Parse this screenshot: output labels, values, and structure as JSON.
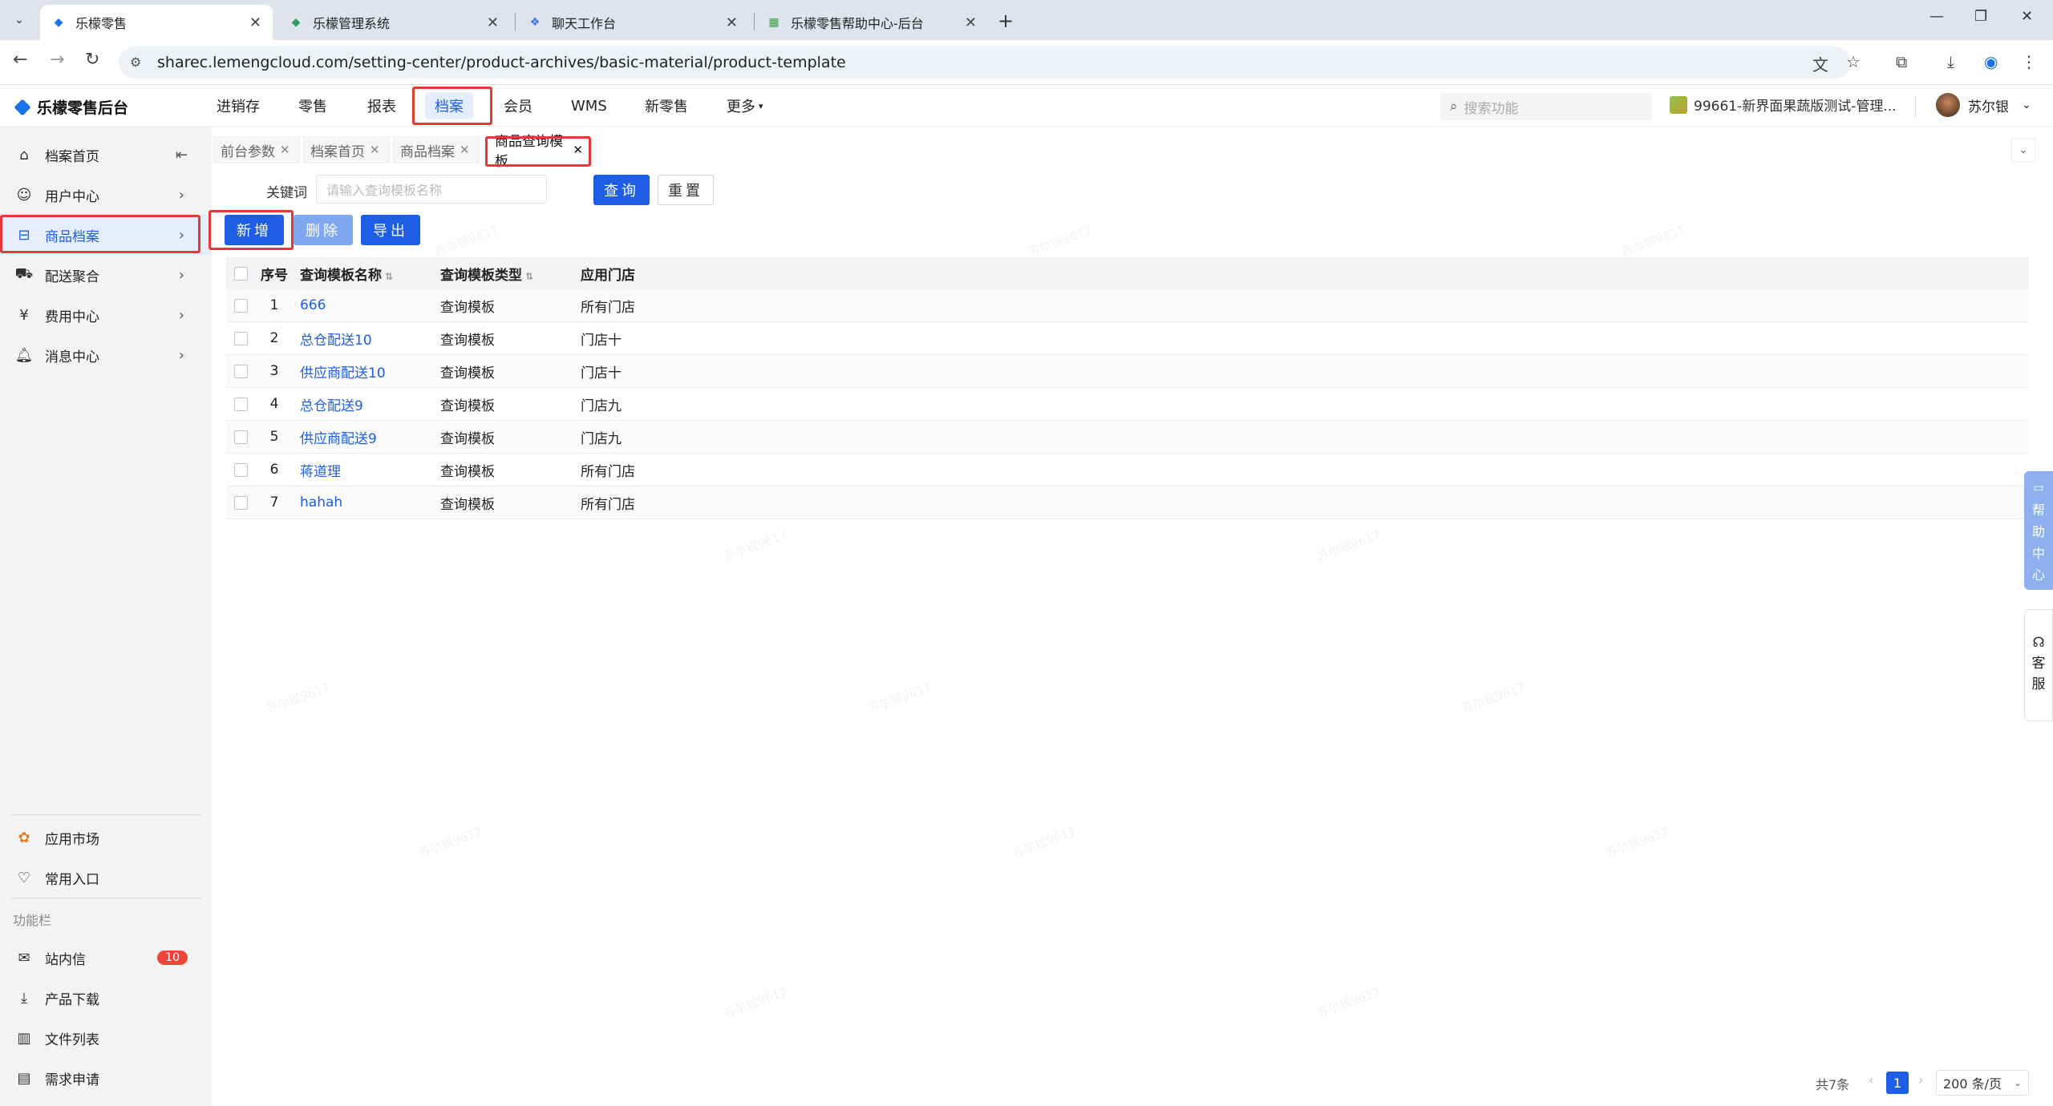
{
  "browser": {
    "tabs": [
      {
        "title": "乐檬零售",
        "icon": "diamond-icon",
        "active": true
      },
      {
        "title": "乐檬管理系统",
        "icon": "diamond-icon",
        "active": false
      },
      {
        "title": "聊天工作台",
        "icon": "chat-icon",
        "active": false
      },
      {
        "title": "乐檬零售帮助中心-后台",
        "icon": "doc-icon",
        "active": false
      }
    ],
    "url": "sharec.lemengcloud.com/setting-center/product-archives/basic-material/product-template"
  },
  "app": {
    "logo_text": "乐檬零售后台",
    "nav": [
      "进销存",
      "零售",
      "报表",
      "档案",
      "会员",
      "WMS",
      "新零售",
      "更多"
    ],
    "active_nav": "档案",
    "search_placeholder": "搜索功能",
    "store_name": "99661-新界面果蔬版测试-管理...",
    "user_name": "苏尔银"
  },
  "sidebar": {
    "items": [
      {
        "label": "档案首页",
        "icon": "home-icon"
      },
      {
        "label": "用户中心",
        "icon": "user-icon"
      },
      {
        "label": "商品档案",
        "icon": "box-icon",
        "active": true
      },
      {
        "label": "配送聚合",
        "icon": "delivery-icon"
      },
      {
        "label": "费用中心",
        "icon": "yen-icon"
      },
      {
        "label": "消息中心",
        "icon": "bell-icon"
      }
    ],
    "bottom_items": [
      {
        "label": "应用市场",
        "icon": "apps-icon"
      },
      {
        "label": "常用入口",
        "icon": "heart-icon"
      }
    ],
    "func_label": "功能栏",
    "func_items": [
      {
        "label": "站内信",
        "icon": "mail-icon",
        "badge": "10"
      },
      {
        "label": "产品下载",
        "icon": "download-icon"
      },
      {
        "label": "文件列表",
        "icon": "chart-icon"
      },
      {
        "label": "需求申请",
        "icon": "message-icon"
      }
    ]
  },
  "page_tabs": [
    {
      "label": "前台参数",
      "active": false
    },
    {
      "label": "档案首页",
      "active": false
    },
    {
      "label": "商品档案",
      "active": false
    },
    {
      "label": "商品查询模板",
      "active": true
    }
  ],
  "filter": {
    "keyword_label": "关键词",
    "keyword_placeholder": "请输入查询模板名称",
    "query_button": "查询",
    "reset_button": "重置"
  },
  "actions": {
    "add": "新增",
    "delete": "删除",
    "export": "导出"
  },
  "table": {
    "headers": [
      "序号",
      "查询模板名称",
      "查询模板类型",
      "应用门店"
    ],
    "rows": [
      {
        "no": "1",
        "name": "666",
        "type": "查询模板",
        "store": "所有门店"
      },
      {
        "no": "2",
        "name": "总仓配送10",
        "type": "查询模板",
        "store": "门店十"
      },
      {
        "no": "3",
        "name": "供应商配送10",
        "type": "查询模板",
        "store": "门店十"
      },
      {
        "no": "4",
        "name": "总仓配送9",
        "type": "查询模板",
        "store": "门店九"
      },
      {
        "no": "5",
        "name": "供应商配送9",
        "type": "查询模板",
        "store": "门店九"
      },
      {
        "no": "6",
        "name": "蒋道理",
        "type": "查询模板",
        "store": "所有门店"
      },
      {
        "no": "7",
        "name": "hahah",
        "type": "查询模板",
        "store": "所有门店"
      }
    ]
  },
  "float": {
    "help": [
      "帮",
      "助",
      "中",
      "心"
    ],
    "service": [
      "客",
      "服"
    ]
  },
  "pagination": {
    "total": "共7条",
    "current": "1",
    "page_size": "200 条/页"
  },
  "watermark": "苏尔银9617"
}
